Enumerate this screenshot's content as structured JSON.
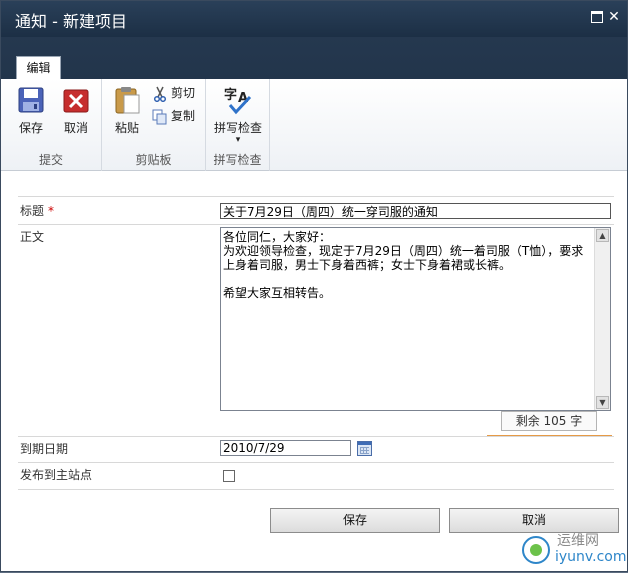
{
  "window": {
    "title": "通知 - 新建项目"
  },
  "ribbon": {
    "tab_label": "编辑",
    "groups": {
      "commit": {
        "label": "提交",
        "save_label": "保存",
        "cancel_label": "取消"
      },
      "clipboard": {
        "label": "剪贴板",
        "paste_label": "粘贴",
        "cut_label": "剪切",
        "copy_label": "复制"
      },
      "spelling": {
        "label": "拼写检查",
        "spell_label": "拼写检查",
        "dropdown_glyph": "▾"
      }
    }
  },
  "form": {
    "title_label": "标题",
    "required_mark": "*",
    "title_value": "关于7月29日（周四）统一穿司服的通知",
    "body_label": "正文",
    "body_value": "各位同仁，大家好：\n为欢迎领导检查，现定于7月29日（周四）统一着司服（T恤），要求上身着司服，男士下身着西裤；女士下身着裙或长裤。\n\n希望大家互相转告。",
    "remaining_chars": "剩余 105 字",
    "due_label": "到期日期",
    "due_value": "2010/7/29",
    "publish_label": "发布到主站点",
    "publish_checked": false
  },
  "buttons": {
    "save_label": "保存",
    "cancel_label": "取消"
  },
  "watermark": {
    "brand": "运维网",
    "url": "iyunv.com"
  },
  "colors": {
    "titlebar": "#1f3349",
    "required": "#cc0000",
    "accent_orange": "#e69a46"
  }
}
